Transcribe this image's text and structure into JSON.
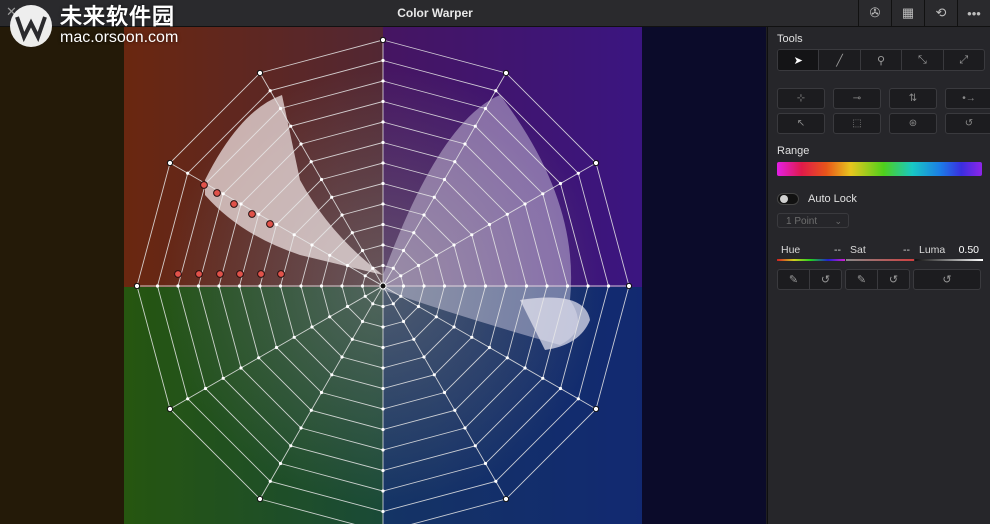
{
  "window": {
    "title": "Color Warper",
    "close_glyph": "✕"
  },
  "watermark": {
    "cn": "未来软件园",
    "url": "mac.orsoon.com"
  },
  "top_icons": [
    {
      "name": "color-wheel-icon",
      "glyph": "✇"
    },
    {
      "name": "grid-icon",
      "glyph": "▦"
    },
    {
      "name": "history-icon",
      "glyph": "⟲"
    },
    {
      "name": "more-options-icon",
      "glyph": "•••"
    }
  ],
  "tools": {
    "label": "Tools",
    "items": [
      {
        "name": "pointer-tool-icon",
        "glyph": "➤"
      },
      {
        "name": "pen-tool-icon",
        "glyph": "╱"
      },
      {
        "name": "pin-tool-icon",
        "glyph": "⚲"
      },
      {
        "name": "collapse-tool-icon",
        "glyph": "⤡"
      },
      {
        "name": "expand-tool-icon",
        "glyph": "⤢"
      }
    ],
    "actions": [
      {
        "name": "add-point-icon",
        "glyph": "⊹"
      },
      {
        "name": "remove-point-icon",
        "glyph": "⊸"
      },
      {
        "name": "swap-icon",
        "glyph": "⇅"
      },
      {
        "name": "dots-arrow-icon",
        "glyph": "•→"
      },
      {
        "name": "select-icon",
        "glyph": "↖"
      },
      {
        "name": "lasso-select-icon",
        "glyph": "⬚"
      },
      {
        "name": "grid-select-icon",
        "glyph": "⊛"
      },
      {
        "name": "reset-icon",
        "glyph": "↺"
      }
    ]
  },
  "range": {
    "label": "Range"
  },
  "auto_lock": {
    "label": "Auto Lock"
  },
  "points_select": {
    "value": "1 Point"
  },
  "hsl": {
    "hue": {
      "label": "Hue",
      "value": "--"
    },
    "sat": {
      "label": "Sat",
      "value": "--"
    },
    "luma": {
      "label": "Luma",
      "value": "0.50"
    }
  },
  "colors": {
    "panel_bg": "#26262a",
    "control_point": "#e0524a"
  }
}
